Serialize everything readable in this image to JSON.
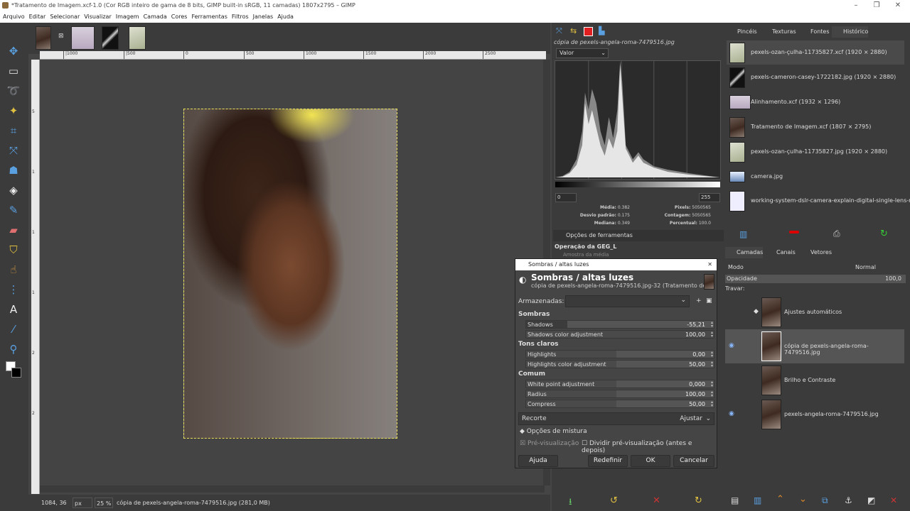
{
  "window": {
    "title": "*Tratamento de Imagem.xcf-1.0 (Cor RGB inteiro de gama de 8 bits, GIMP built-in sRGB, 11 camadas) 1807x2795 – GIMP"
  },
  "menu": [
    "Arquivo",
    "Editar",
    "Selecionar",
    "Visualizar",
    "Imagem",
    "Camada",
    "Cores",
    "Ferramentas",
    "Filtros",
    "Janelas",
    "Ajuda"
  ],
  "ruler": {
    "h": [
      "|1000",
      "|500",
      "0",
      "500",
      "1000",
      "1500",
      "2000",
      "2500"
    ],
    "v": [
      "5",
      "1",
      "1",
      "1",
      "2",
      "2"
    ]
  },
  "status": {
    "coords": "1084, 36",
    "unit": "px",
    "zoom": "25 %",
    "info": "cópia de pexels-angela-roma-7479516.jpg (281,0 MB)"
  },
  "histogram": {
    "layer": "cópia de pexels-angela-roma-7479516.jpg",
    "channel": "Valor",
    "range_min": "0",
    "range_max": "255",
    "stats": [
      {
        "k": "Média:",
        "v": "0.382"
      },
      {
        "k": "Desvio padrão:",
        "v": "0.175"
      },
      {
        "k": "Mediana:",
        "v": "0.349"
      }
    ],
    "stats2": [
      {
        "k": "Pixels:",
        "v": "5050565"
      },
      {
        "k": "Contagem:",
        "v": "5050565"
      },
      {
        "k": "Percentual:",
        "v": "100.0"
      }
    ]
  },
  "tool_options": {
    "tab": "Opções de ferramentas",
    "operation": "Operação da GEG_L",
    "sample": "Amostra da média"
  },
  "docks": {
    "right_tabs": [
      "Pincéis",
      "Texturas",
      "Fontes",
      "Histórico"
    ],
    "layer_tabs": [
      "Camadas",
      "Canais",
      "Vetores"
    ]
  },
  "history": [
    {
      "name": "pexels-ozan-çulha-11735827.xcf (1920 × 2880)"
    },
    {
      "name": "pexels-cameron-casey-1722182.jpg (1920 × 2880)"
    },
    {
      "name": "Alinhamento.xcf (1932 × 1296)"
    },
    {
      "name": "Tratamento de Imagem.xcf (1807 × 2795)"
    },
    {
      "name": "pexels-ozan-çulha-11735827.jpg (1920 × 2880)"
    },
    {
      "name": "camera.jpg"
    },
    {
      "name": "working-system-dslr-camera-explain-digital-single-lens-r"
    }
  ],
  "layers_panel": {
    "mode_label": "Modo",
    "mode_value": "Normal",
    "opacity_label": "Opacidade",
    "opacity_value": "100,0",
    "lock_label": "Travar:"
  },
  "layers": [
    {
      "name": "Ajustes automáticos"
    },
    {
      "name": "cópia de pexels-angela-roma-7479516.jpg"
    },
    {
      "name": "Brilho e Contraste"
    },
    {
      "name": "pexels-angela-roma-7479516.jpg"
    }
  ],
  "dialog": {
    "window_title": "Sombras / altas luzes",
    "heading": "Sombras / altas luzes",
    "subheading": "cópia de pexels-angela-roma-7479516.jpg-32 (Tratamento de...",
    "presets_label": "Armazenadas:",
    "sec_shadows": "Sombras",
    "sec_highlights": "Tons claros",
    "sec_common": "Comum",
    "sliders": [
      {
        "label": "Shadows",
        "value": "-55,21",
        "frac": 0.22
      },
      {
        "label": "Shadows color adjustment",
        "value": "100,00",
        "frac": 1.0
      },
      {
        "label": "Highlights",
        "value": "0,00",
        "frac": 0.5
      },
      {
        "label": "Highlights color adjustment",
        "value": "50,00",
        "frac": 0.5
      },
      {
        "label": "White point adjustment",
        "value": "0,000",
        "frac": 0.5
      },
      {
        "label": "Radius",
        "value": "100,00",
        "frac": 0.5
      },
      {
        "label": "Compress",
        "value": "50,00",
        "frac": 0.5
      }
    ],
    "clip_label": "Recorte",
    "clip_value": "Ajustar",
    "blend_options": "Opções de mistura",
    "preview": "Pré-visualização",
    "split_preview": "Dividir pré-visualização (antes e depois)",
    "buttons": {
      "help": "Ajuda",
      "reset": "Redefinir",
      "ok": "OK",
      "cancel": "Cancelar"
    }
  }
}
